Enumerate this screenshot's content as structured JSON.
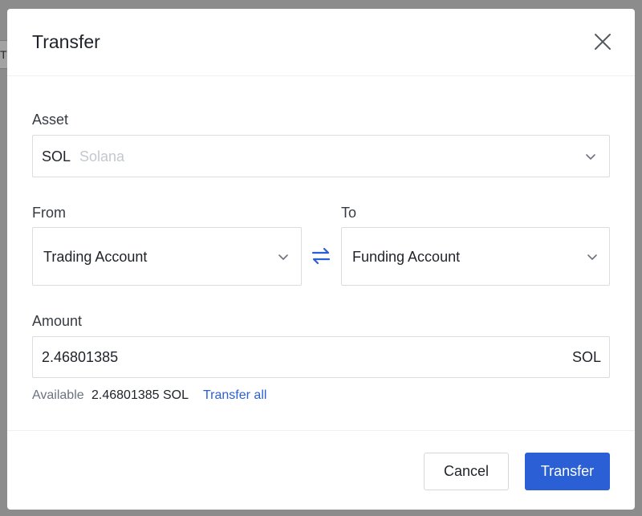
{
  "dialog": {
    "title": "Transfer",
    "close_icon": "close-icon"
  },
  "asset": {
    "label": "Asset",
    "symbol": "SOL",
    "name": "Solana"
  },
  "from": {
    "label": "From",
    "value": "Trading Account"
  },
  "to": {
    "label": "To",
    "value": "Funding Account"
  },
  "swap_icon": "swap-arrows-icon",
  "amount": {
    "label": "Amount",
    "value": "2.46801385",
    "unit": "SOL"
  },
  "available": {
    "label": "Available",
    "value": "2.46801385 SOL",
    "transfer_all": "Transfer all"
  },
  "footer": {
    "cancel_label": "Cancel",
    "transfer_label": "Transfer"
  },
  "background": {
    "partial_text": "T"
  },
  "colors": {
    "accent": "#2b5fd6",
    "overlay": "#8c8c8c"
  }
}
